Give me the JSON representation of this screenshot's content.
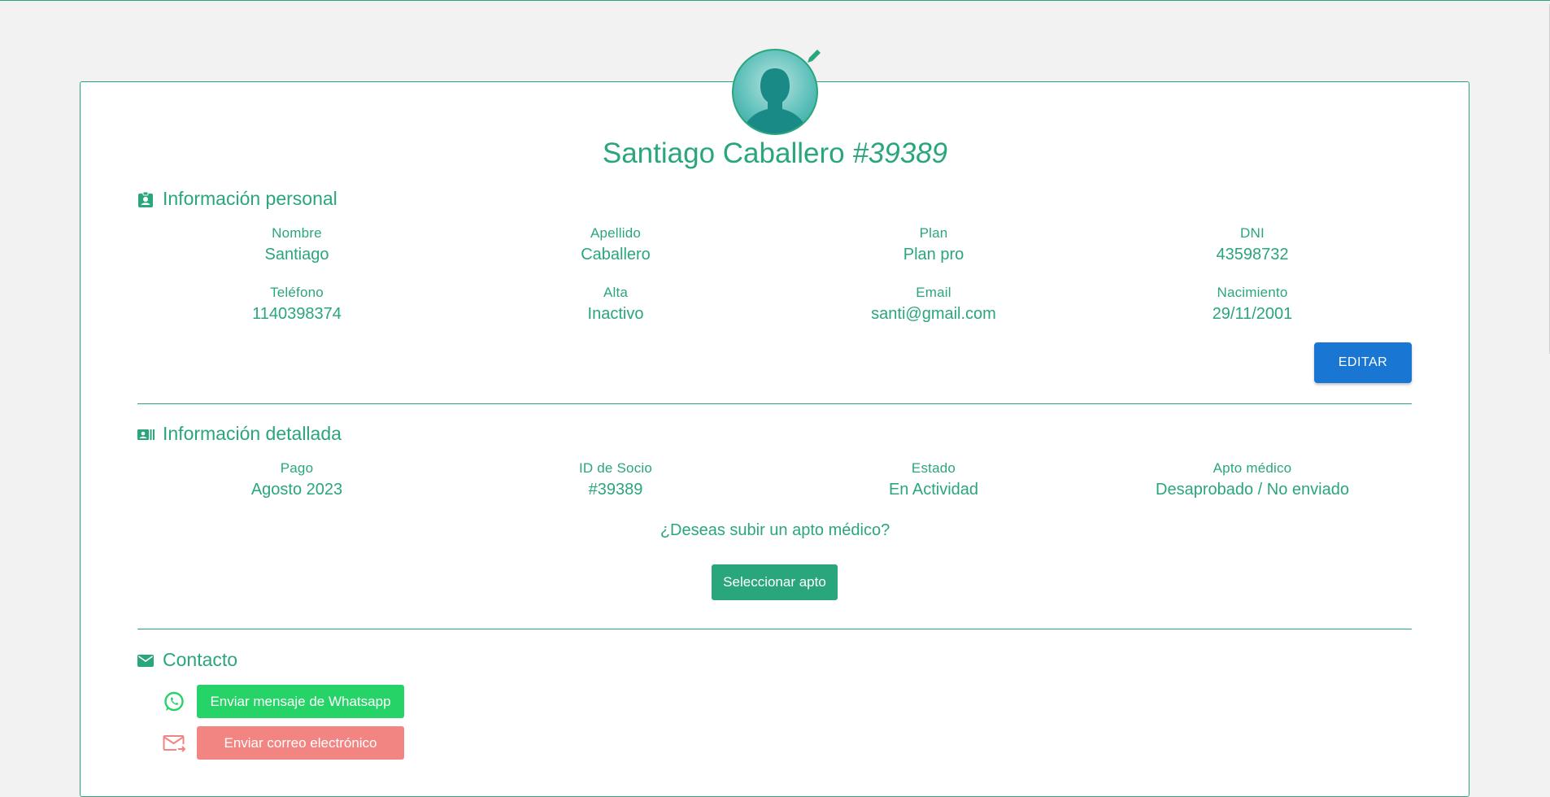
{
  "profile": {
    "name": "Santiago Caballero",
    "id_hash": "#39389",
    "avatar_icon": "user-avatar",
    "edit_icon": "pencil-icon"
  },
  "personal": {
    "heading": "Información personal",
    "icon": "badge-icon",
    "fields": [
      {
        "label": "Nombre",
        "value": "Santiago"
      },
      {
        "label": "Apellido",
        "value": "Caballero"
      },
      {
        "label": "Plan",
        "value": "Plan pro"
      },
      {
        "label": "DNI",
        "value": "43598732"
      },
      {
        "label": "Teléfono",
        "value": "1140398374"
      },
      {
        "label": "Alta",
        "value": "Inactivo"
      },
      {
        "label": "Email",
        "value": "santi@gmail.com"
      },
      {
        "label": "Nacimiento",
        "value": "29/11/2001"
      }
    ],
    "edit_label": "EDITAR"
  },
  "detailed": {
    "heading": "Información detallada",
    "icon": "id-card-icon",
    "fields": [
      {
        "label": "Pago",
        "value": "Agosto 2023"
      },
      {
        "label": "ID de Socio",
        "value": "#39389"
      },
      {
        "label": "Estado",
        "value": "En Actividad"
      },
      {
        "label": "Apto médico",
        "value": "Desaprobado / No enviado"
      }
    ],
    "question": "¿Deseas subir un apto médico?",
    "select_label": "Seleccionar apto"
  },
  "contact": {
    "heading": "Contacto",
    "icon": "mail-icon",
    "whatsapp_label": "Enviar mensaje de Whatsapp",
    "email_label": "Enviar correo electrónico"
  },
  "colors": {
    "accent": "#2aa67c",
    "primary": "#1976d2",
    "whatsapp": "#25d366",
    "email": "#f28482",
    "background": "#f2f2f2"
  }
}
